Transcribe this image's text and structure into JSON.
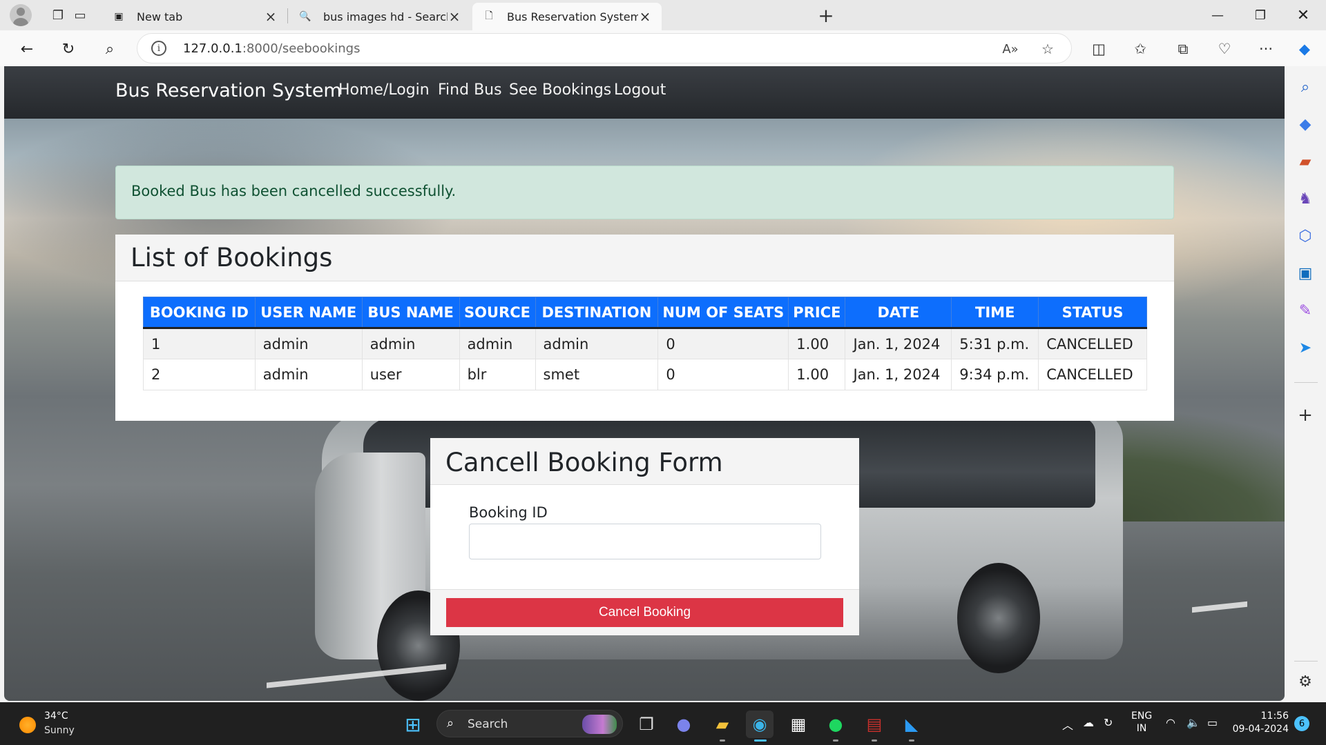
{
  "browser": {
    "tabs": [
      {
        "label": "New tab",
        "icon": "new-tab-page-icon"
      },
      {
        "label": "bus images hd - Search",
        "icon": "search-icon"
      },
      {
        "label": "Bus Reservation System in Djang",
        "icon": "document-icon"
      }
    ],
    "address": {
      "host": "127.0.0.1",
      "rest": ":8000/seebookings"
    }
  },
  "site": {
    "brand": "Bus Reservation System",
    "nav": [
      "Home/Login",
      "Find Bus",
      "See Bookings",
      "Logout"
    ]
  },
  "alert": {
    "message": "Booked Bus has been cancelled successfully.",
    "color": "#d1e7dd"
  },
  "bookings": {
    "title": "List of Bookings",
    "columns": [
      "BOOKING ID",
      "USER NAME",
      "BUS NAME",
      "SOURCE",
      "DESTINATION",
      "NUM OF SEATS",
      "PRICE",
      "DATE",
      "TIME",
      "STATUS"
    ],
    "rows": [
      [
        "1",
        "admin",
        "admin",
        "admin",
        "admin",
        "0",
        "1.00",
        "Jan. 1, 2024",
        "5:31 p.m.",
        "CANCELLED"
      ],
      [
        "2",
        "admin",
        "user",
        "blr",
        "smet",
        "0",
        "1.00",
        "Jan. 1, 2024",
        "9:34 p.m.",
        "CANCELLED"
      ]
    ],
    "header_color": "#0d6efd"
  },
  "cancel_form": {
    "title": "Cancell Booking Form",
    "field_label": "Booking ID",
    "field_value": "",
    "button": "Cancel Booking",
    "button_color": "#dc3545"
  },
  "taskbar": {
    "weather": {
      "temp": "34°C",
      "condition": "Sunny"
    },
    "search": "Search",
    "lang": "ENG",
    "region": "IN",
    "time": "11:56",
    "date": "09-04-2024",
    "notifications": "6"
  }
}
